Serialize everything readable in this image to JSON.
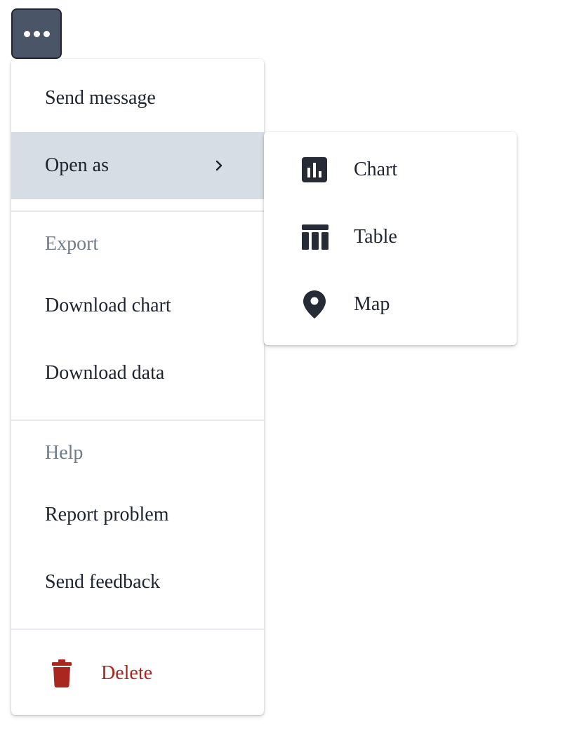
{
  "trigger": {
    "icon": "more-horizontal-icon"
  },
  "menu": {
    "send_message": "Send message",
    "open_as": "Open as",
    "export_heading": "Export",
    "download_chart": "Download chart",
    "download_data": "Download data",
    "help_heading": "Help",
    "report_problem": "Report problem",
    "send_feedback": "Send feedback",
    "delete": "Delete"
  },
  "submenu": {
    "items": [
      {
        "label": "Chart",
        "icon": "bar-chart-icon"
      },
      {
        "label": "Table",
        "icon": "table-icon"
      },
      {
        "label": "Map",
        "icon": "map-pin-icon"
      }
    ]
  },
  "colors": {
    "trigger_bg": "#4b5568",
    "active_bg": "#d7dde5",
    "heading_text": "#717b8b",
    "danger": "#a9271f",
    "text": "#1f2430"
  }
}
